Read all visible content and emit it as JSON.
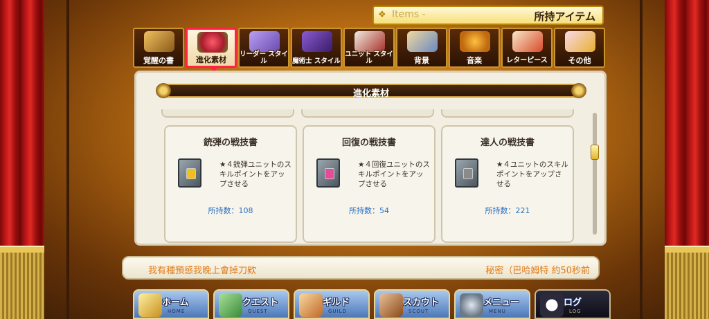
{
  "header": {
    "en": "Items -",
    "jp": "所持アイテム"
  },
  "tabs": [
    {
      "label": "覚醒の書",
      "icon": "book-icon",
      "color": "#c98a2a"
    },
    {
      "label": "進化素材",
      "icon": "flower-icon",
      "color": "#d43a4a",
      "active": true
    },
    {
      "label": "リーダー スタイル",
      "icon": "card-swap-icon",
      "color": "#8a6ad8"
    },
    {
      "label": "魔術士 スタイル",
      "icon": "mage-hat-icon",
      "color": "#6a3aa8"
    },
    {
      "label": "ユニット スタイル",
      "icon": "gift-box-icon",
      "color": "#c8c0b0"
    },
    {
      "label": "背景",
      "icon": "picture-icon",
      "color": "#d8b068"
    },
    {
      "label": "音楽",
      "icon": "music-note-icon",
      "color": "#e89820"
    },
    {
      "label": "レターピース",
      "icon": "letter-icon",
      "color": "#e86a3a"
    },
    {
      "label": "その他",
      "icon": "misc-items-icon",
      "color": "#e8b8c8"
    }
  ],
  "section": {
    "title": "進化素材"
  },
  "items": [
    {
      "name": "銃弾の戦技書",
      "desc": "★４銃弾ユニットのスキルポイントをアップさせる",
      "count_label": "所持数：",
      "count": "108",
      "gem_color": "#f0c020"
    },
    {
      "name": "回復の戦技書",
      "desc": "★４回復ユニットのスキルポイントをアップさせる",
      "count_label": "所持数：",
      "count": "54",
      "gem_color": "#e84a9a"
    },
    {
      "name": "達人の戦技書",
      "desc": "★４ユニットのスキルポイントをアップさせる",
      "count_label": "所持数：",
      "count": "221",
      "gem_color": "#8a8a8a"
    }
  ],
  "chat": {
    "message": "我有種預感我晚上會掉刀欸",
    "meta": "秘密（巴哈姆特 約50秒前"
  },
  "nav": [
    {
      "label": "ホーム",
      "sub": "HOME",
      "icon": "home-tent-icon",
      "color": "#e8c040"
    },
    {
      "label": "クエスト",
      "sub": "QUEST",
      "icon": "quest-map-icon",
      "color": "#5ab050"
    },
    {
      "label": "ギルド",
      "sub": "GUILD",
      "icon": "guild-castle-icon",
      "color": "#e8a050"
    },
    {
      "label": "スカウト",
      "sub": "SCOUT",
      "icon": "scout-book-icon",
      "color": "#c8844a"
    },
    {
      "label": "メニュー",
      "sub": "MENU",
      "icon": "menu-gear-icon",
      "color": "#9aa8b8"
    },
    {
      "label": "ログ",
      "sub": "LOG",
      "icon": "chat-log-icon",
      "color": "#ffffff"
    }
  ]
}
